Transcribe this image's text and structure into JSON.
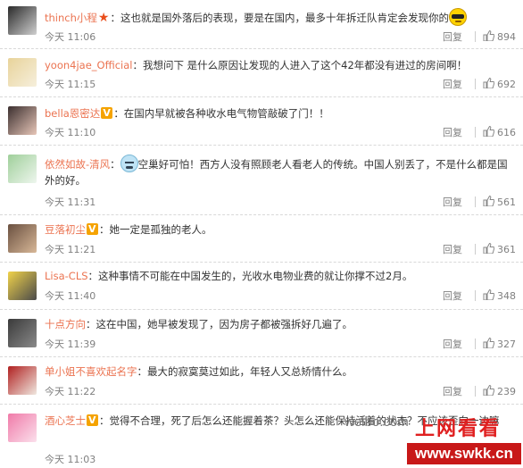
{
  "comments": [
    {
      "user": "thinch小程",
      "badge": "star",
      "text": "：这也就是国外落后的表现，要是在国内，最多十年拆迁队肯定会发现你的",
      "emoji": "cool",
      "time": "今天 11:06",
      "reply": "回复",
      "likes": "894",
      "avatar_colors": [
        "#2a2a2a",
        "#cfcfcf"
      ]
    },
    {
      "user": "yoon4jae_Official",
      "badge": "",
      "text": "：我想问下 是什么原因让发现的人进入了这个42年都没有进过的房间啊！",
      "emoji": "",
      "time": "今天 11:15",
      "reply": "回复",
      "likes": "692",
      "avatar_colors": [
        "#e8d39a",
        "#f6efdc"
      ]
    },
    {
      "user": "bella恩密达",
      "badge": "gold",
      "text": "：在国内早就被各种收水电气物管敲破了门！！",
      "emoji": "",
      "time": "今天 11:10",
      "reply": "回复",
      "likes": "616",
      "avatar_colors": [
        "#3b2f2f",
        "#e7c6b8"
      ]
    },
    {
      "user": "依然如故-清风",
      "badge": "",
      "text": "：",
      "emoji": "sweat",
      "text_after": "空巢好可怕！西方人没有照顾老人看老人的传统。中国人别丢了，不是什么都是国外的好。",
      "time": "今天 11:31",
      "reply": "回复",
      "likes": "561",
      "avatar_colors": [
        "#9fcf9a",
        "#eef6ee"
      ]
    },
    {
      "user": "豆落初尘",
      "badge": "gold",
      "text": "：她一定是孤独的老人。",
      "emoji": "",
      "time": "今天 11:21",
      "reply": "回复",
      "likes": "361",
      "avatar_colors": [
        "#6a5040",
        "#d8b898"
      ]
    },
    {
      "user": "Lisa-CLS",
      "badge": "",
      "text": "：这种事情不可能在中国发生的，光收水电物业费的就让你撑不过2月。",
      "emoji": "",
      "time": "今天 11:40",
      "reply": "回复",
      "likes": "348",
      "avatar_colors": [
        "#f1d34a",
        "#4a4a4a"
      ]
    },
    {
      "user": "十点方向",
      "badge": "",
      "text": "：这在中国，她早被发现了，因为房子都被强拆好几遍了。",
      "emoji": "",
      "time": "今天 11:39",
      "reply": "回复",
      "likes": "327",
      "avatar_colors": [
        "#3a3a3a",
        "#8a8a8a"
      ]
    },
    {
      "user": "单小姐不喜欢起名字",
      "badge": "",
      "text": "：最大的寂寞莫过如此，年轻人又总矫情什么。",
      "emoji": "",
      "time": "今天 11:22",
      "reply": "回复",
      "likes": "239",
      "avatar_colors": [
        "#b02020",
        "#f0e8e0"
      ]
    },
    {
      "user": "酒心芝士",
      "badge": "gold",
      "text": "：觉得不合理，死了后怎么还能握着茶？头怎么还能保持活着的状态？不应该歪向一边嘛",
      "emoji": "",
      "time": "今天 11:03",
      "reply": "回复",
      "likes": "",
      "avatar_colors": [
        "#f07aa8",
        "#fbe0ec"
      ]
    }
  ],
  "watermark": {
    "weibo": "weibo.com",
    "logo": "上网看看",
    "url": "www.swkk.cn"
  }
}
